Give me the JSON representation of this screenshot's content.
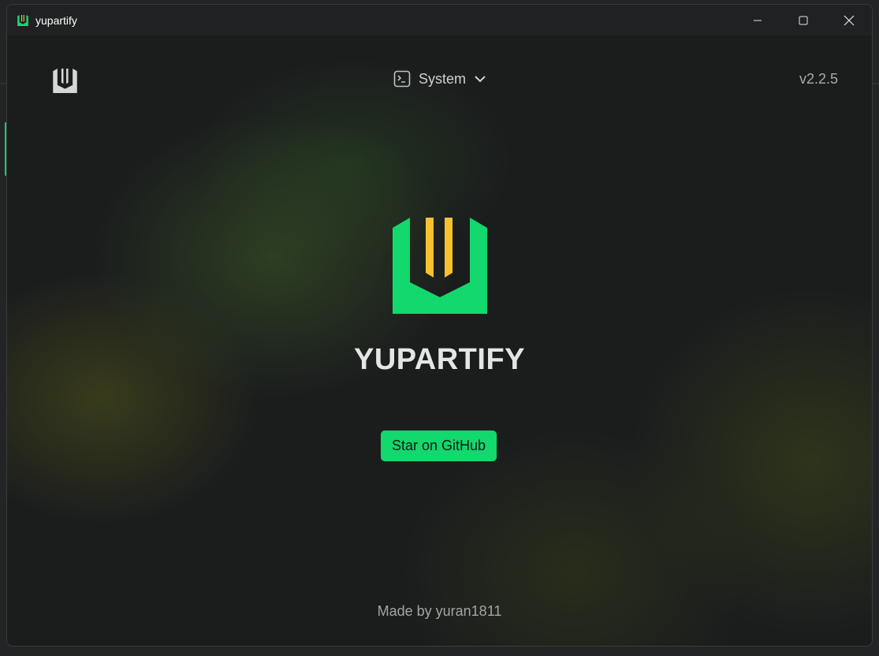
{
  "window": {
    "title": "yupartify",
    "controls": {
      "minimize_icon": "minimize-icon",
      "maximize_icon": "maximize-icon",
      "close_icon": "close-icon"
    }
  },
  "header": {
    "shell_label": "System",
    "shell_icon": "terminal-icon",
    "version": "v2.2.5"
  },
  "main": {
    "brand": "YUPARTIFY",
    "star_button": "Star on GitHub"
  },
  "footer": {
    "credit": "Made by yuran1811"
  },
  "colors": {
    "accent": "#12d86d",
    "logo_bars": "#f5c131",
    "text": "#e4e6e5"
  }
}
